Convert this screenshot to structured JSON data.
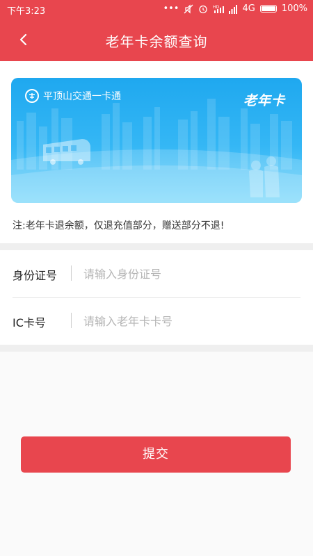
{
  "status_bar": {
    "time": "下午3:23",
    "network": "4G",
    "battery": "100%",
    "icons": [
      "more-dots-icon",
      "silent-icon",
      "alarm-icon",
      "hd-signal-icon",
      "signal-icon",
      "battery-icon"
    ]
  },
  "header": {
    "title": "老年卡余额查询",
    "back_icon": "chevron-left-icon"
  },
  "card": {
    "issuer": "平顶山交通一卡通",
    "type": "老年卡",
    "image_elements": [
      "city-skyline",
      "bus",
      "elderly-couple"
    ]
  },
  "note": "注:老年卡退余额，仅退充值部分，赠送部分不退!",
  "form": {
    "id_label": "身份证号",
    "id_placeholder": "请输入身份证号",
    "ic_label": "IC卡号",
    "ic_placeholder": "请输入老年卡卡号"
  },
  "submit_label": "提交",
  "colors": {
    "primary": "#e8464e",
    "card_blue": "#1fa8ef"
  }
}
